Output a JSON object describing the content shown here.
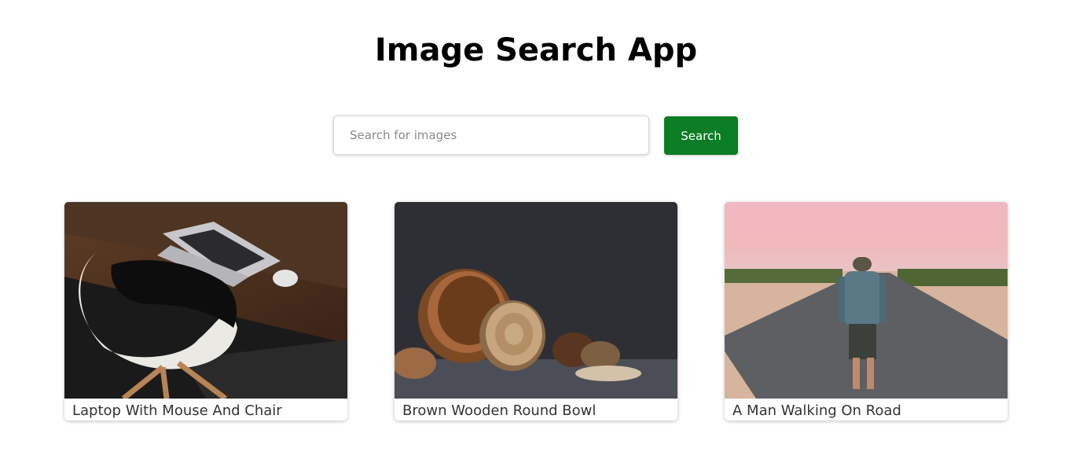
{
  "header": {
    "title": "Image Search App"
  },
  "search": {
    "placeholder": "Search for images",
    "value": "",
    "button_label": "Search"
  },
  "colors": {
    "button_bg": "#0b7d24",
    "button_text": "#ffffff",
    "title_text": "#000000",
    "caption_text": "#333333"
  },
  "results": [
    {
      "caption": "Laptop With Mouse And Chair"
    },
    {
      "caption": "Brown Wooden Round Bowl"
    },
    {
      "caption": "A Man Walking On Road"
    }
  ]
}
